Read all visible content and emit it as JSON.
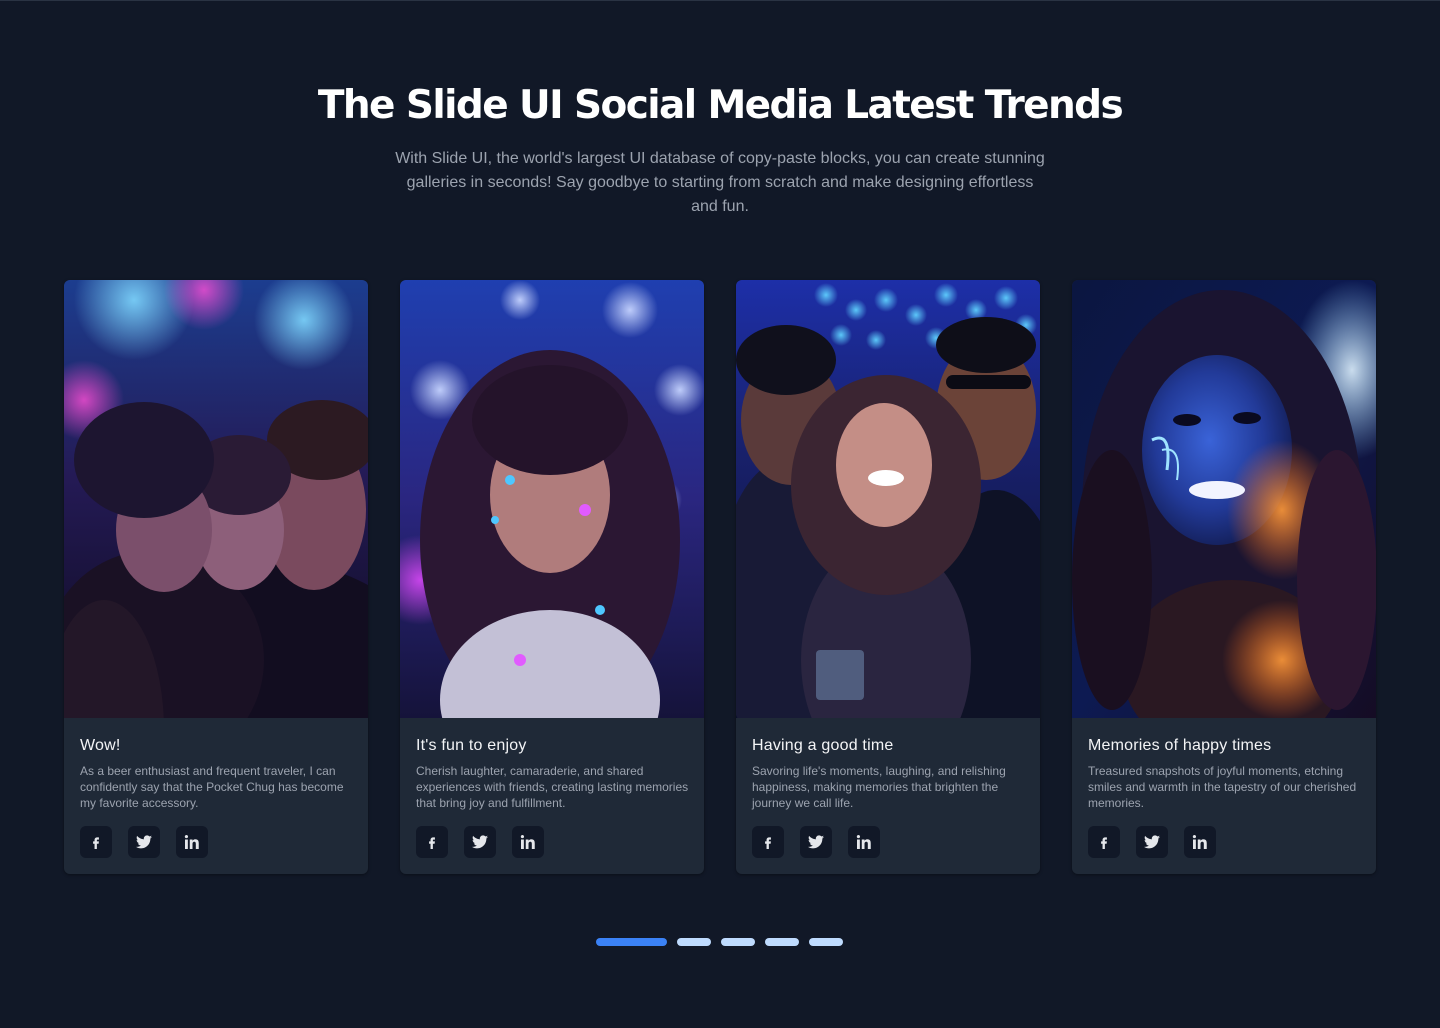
{
  "header": {
    "title": "The Slide UI Social Media Latest Trends",
    "subtitle": "With Slide UI, the world's largest UI database of copy-paste blocks, you can create stunning galleries in seconds! Say goodbye to starting from scratch and make designing effortless and fun."
  },
  "cards": [
    {
      "title": "Wow!",
      "text": "As a beer enthusiast and frequent traveler, I can confidently say that the Pocket Chug has become my favorite accessory.",
      "image": "friends-hugging-neon-party-photo"
    },
    {
      "title": "It's fun to enjoy",
      "text": "Cherish laughter, camaraderie, and shared experiences with friends, creating lasting memories that bring joy and fulfillment.",
      "image": "woman-smiling-paint-neon-photo"
    },
    {
      "title": "Having a good time",
      "text": "Savoring life's moments, laughing, and relishing happiness, making memories that brighten the journey we call life.",
      "image": "three-friends-laughing-party-photo"
    },
    {
      "title": "Memories of happy times",
      "text": "Treasured snapshots of joyful moments, etching smiles and warmth in the tapestry of our cherished memories.",
      "image": "woman-uv-face-paint-photo"
    }
  ],
  "social_icons": [
    "facebook-icon",
    "twitter-icon",
    "linkedin-icon"
  ],
  "carousel": {
    "total": 5,
    "active_index": 0
  },
  "colors": {
    "background": "#111827",
    "card": "#1f2937",
    "accent": "#3b82f6",
    "dot_inactive": "#bfdbfe"
  }
}
